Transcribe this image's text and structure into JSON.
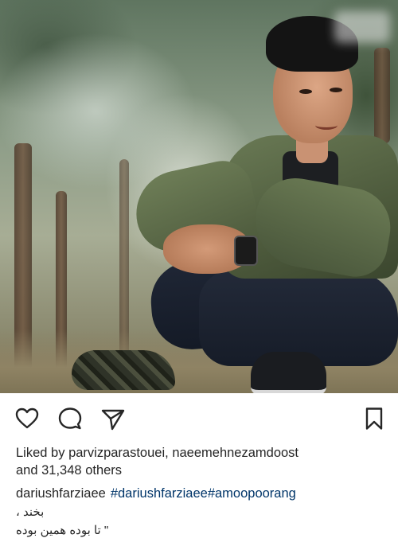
{
  "photo": {
    "icon": "photo-man-sitting-outdoors"
  },
  "actions": {
    "like_icon": "heart-icon",
    "comment_icon": "comment-icon",
    "share_icon": "paper-plane-icon",
    "save_icon": "bookmark-icon"
  },
  "likes": {
    "prefix": "Liked by",
    "user1": "parvizparastouei",
    "separator": ", ",
    "user2": "naeemehnezamdoost",
    "and": "and",
    "count": "31,348",
    "others": "others"
  },
  "caption": {
    "username": "dariushfarziaee",
    "hashtag1": "#dariushfarziaee",
    "hashtag2": "#amoopoorang",
    "line1": "بخند ،",
    "line2": "\" تا بوده همین بوده"
  },
  "colors": {
    "text": "#262626",
    "hashtag": "#003569",
    "background": "#ffffff"
  }
}
